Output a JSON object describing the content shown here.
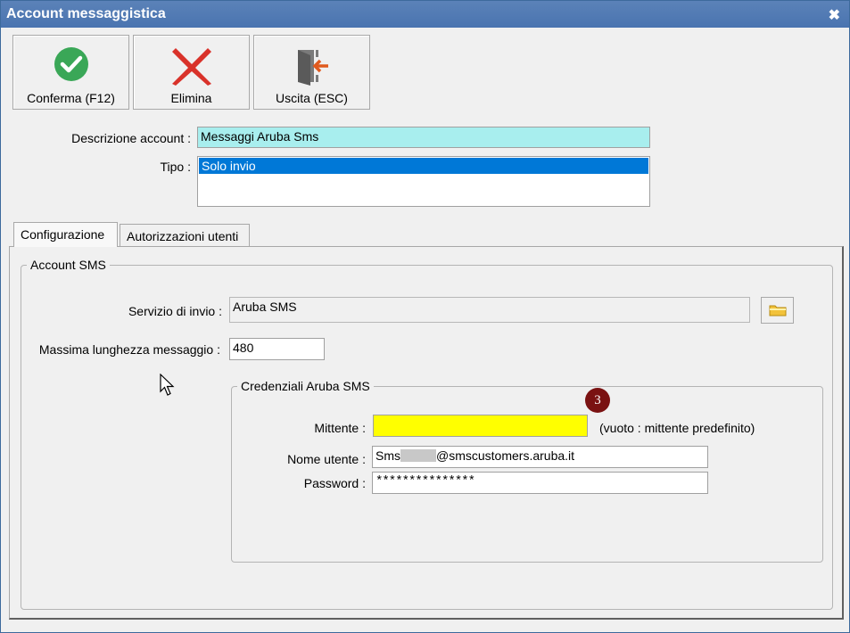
{
  "window": {
    "title": "Account messaggistica"
  },
  "toolbar": {
    "confirm_label": "Conferma (F12)",
    "delete_label": "Elimina",
    "exit_label": "Uscita (ESC)"
  },
  "form": {
    "description_label": "Descrizione account :",
    "description_value": "Messaggi Aruba Sms",
    "type_label": "Tipo :",
    "type_options": [
      "Solo invio"
    ],
    "type_selected": "Solo invio"
  },
  "tabs": [
    {
      "label": "Configurazione",
      "active": true
    },
    {
      "label": "Autorizzazioni utenti",
      "active": false
    }
  ],
  "sms_account": {
    "group_label": "Account SMS",
    "service_label": "Servizio di invio :",
    "service_value": "Aruba SMS",
    "max_length_label": "Massima lunghezza messaggio :",
    "max_length_value": "480"
  },
  "credentials": {
    "group_label": "Credenziali Aruba SMS",
    "sender_label": "Mittente :",
    "sender_value": "",
    "sender_hint": "(vuoto : mittente predefinito)",
    "username_label": "Nome utente :",
    "username_prefix": "Sms",
    "username_suffix": "@smscustomers.aruba.it",
    "password_label": "Password :",
    "password_value": "***************"
  },
  "annotation": {
    "step_number": "3"
  },
  "icons": {
    "confirm": "check-circle-icon",
    "delete": "x-icon",
    "exit": "exit-door-icon",
    "browse": "folder-icon",
    "close": "close-icon",
    "cursor": "mouse-pointer-icon"
  },
  "colors": {
    "titlebar": "#4a74b0",
    "description_field_bg": "#a8eeee",
    "selection_bg": "#0078d7",
    "sender_field_bg": "#ffff00",
    "confirm_green": "#3aa757",
    "delete_red": "#d9322a",
    "badge_bg": "#7a1212"
  }
}
